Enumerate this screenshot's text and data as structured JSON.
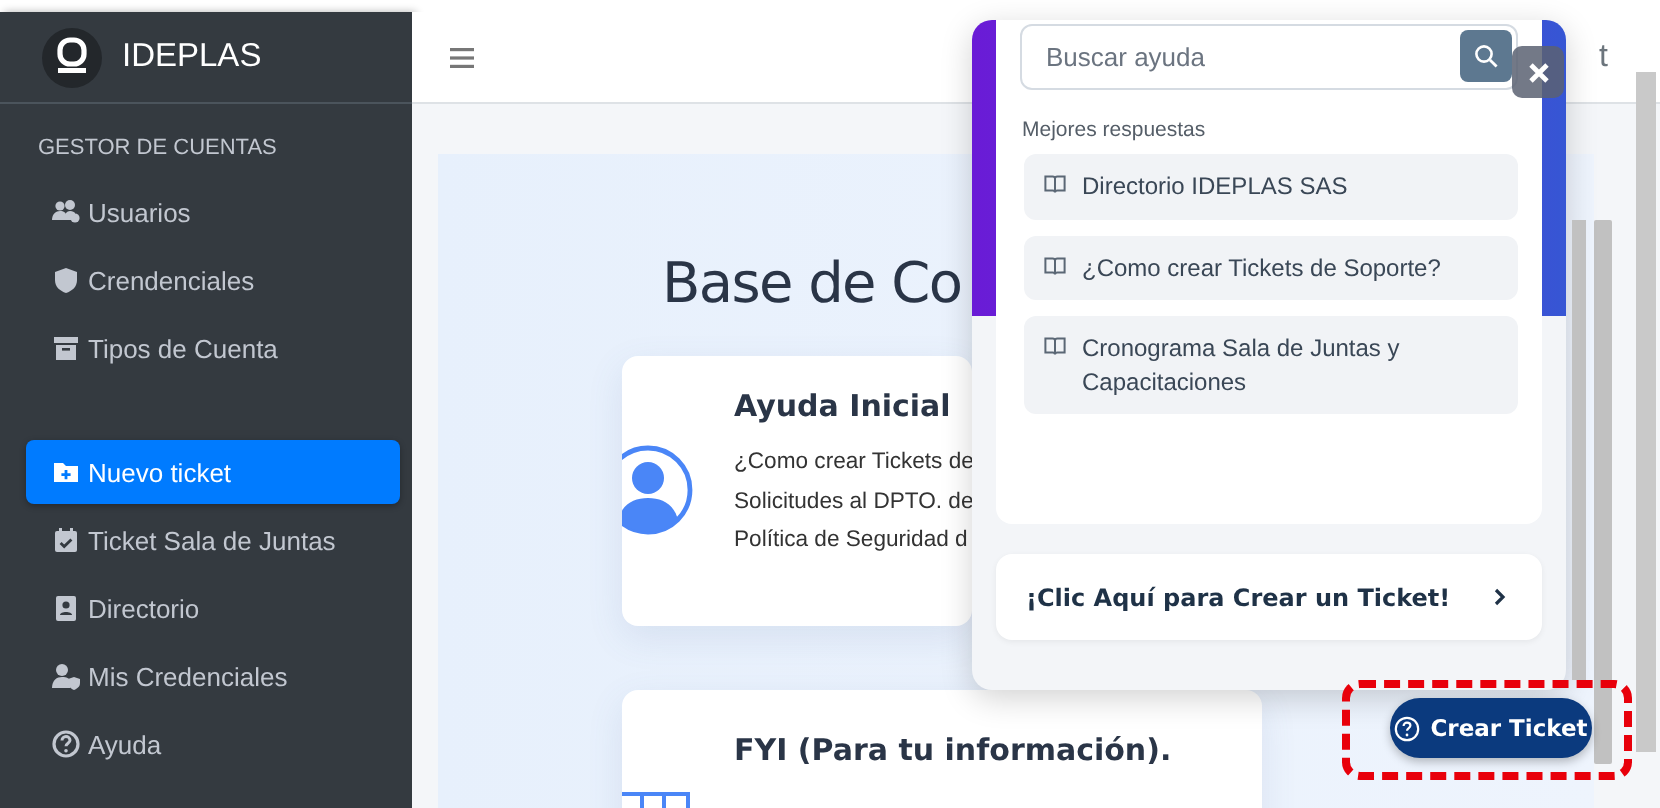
{
  "sidebar": {
    "brand": "IDEPLAS",
    "groups": [
      {
        "title": "GESTOR DE CUENTAS",
        "items": [
          {
            "label": "Usuarios",
            "selected": false
          },
          {
            "label": "Crendenciales",
            "selected": false
          },
          {
            "label": "Tipos de Cuenta",
            "selected": false
          }
        ]
      },
      {
        "items": [
          {
            "label": "Nuevo ticket",
            "selected": true
          },
          {
            "label": "Ticket Sala de Juntas",
            "selected": false
          },
          {
            "label": "Directorio",
            "selected": false
          },
          {
            "label": "Mis Credenciales",
            "selected": false
          },
          {
            "label": "Ayuda",
            "selected": false
          }
        ]
      }
    ]
  },
  "header": {
    "right_text": "t"
  },
  "main": {
    "title": "Base de Co",
    "cards": [
      {
        "title": "Ayuda Inicial",
        "lines": [
          "¿Como crear Tickets de",
          "Solicitudes al DPTO. de",
          "Política de Seguridad d"
        ]
      },
      {
        "title": "FYI (Para tu información)."
      }
    ]
  },
  "help_widget": {
    "search": {
      "placeholder": "Buscar ayuda"
    },
    "results_heading": "Mejores respuestas",
    "results": [
      "Directorio IDEPLAS SAS",
      "¿Como crear Tickets de Soporte?",
      "Cronograma Sala de Juntas y Capacitaciones"
    ],
    "cta": "¡Clic Aquí para Crear un Ticket!"
  },
  "launcher": {
    "label": "Crear Ticket",
    "highlighted": true
  }
}
